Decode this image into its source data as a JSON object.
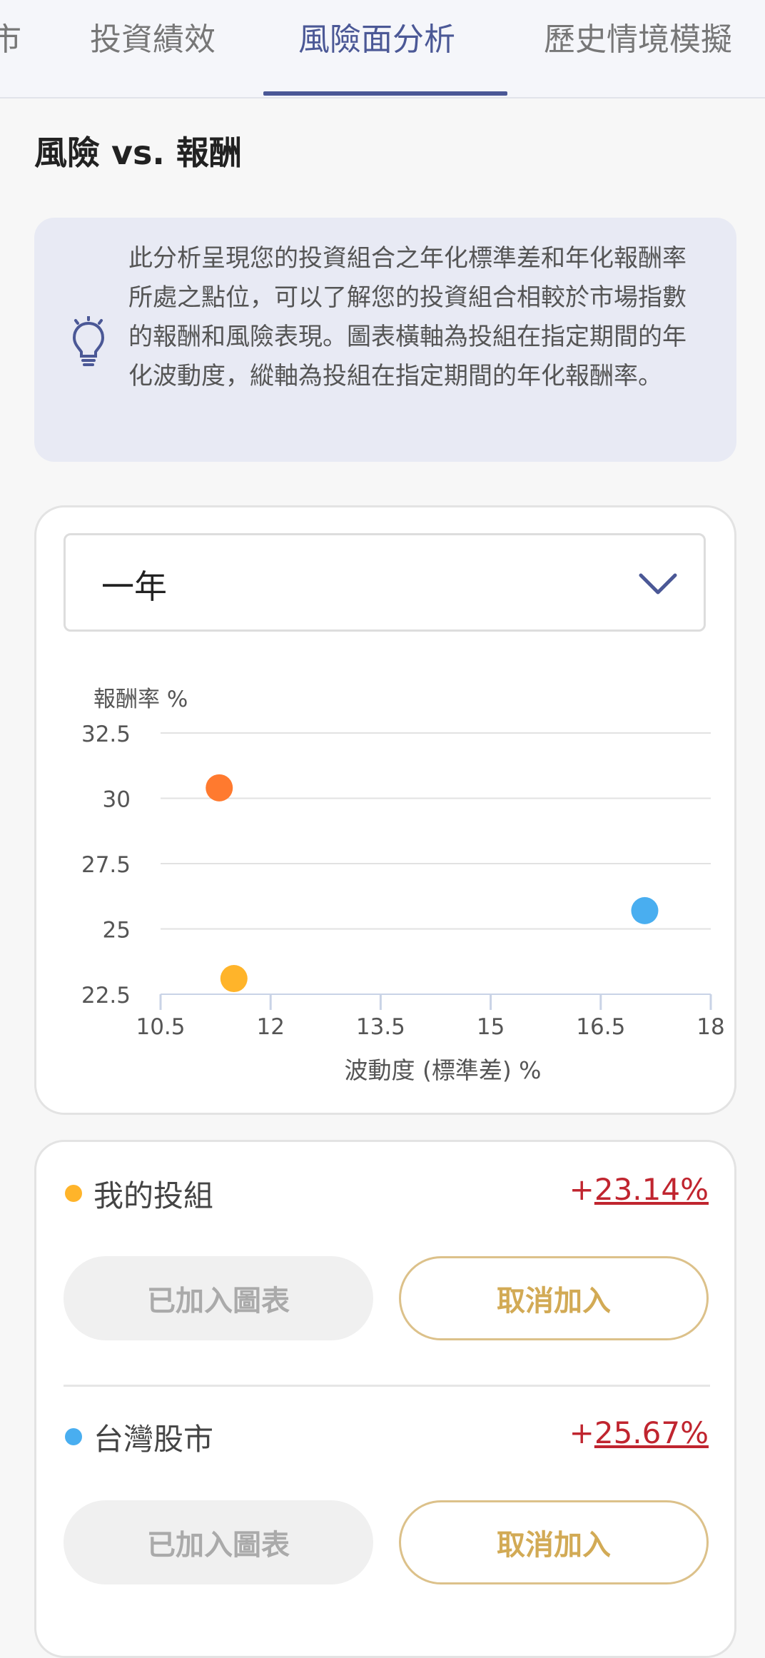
{
  "tabs": [
    {
      "label": "市"
    },
    {
      "label": "投資績效"
    },
    {
      "label": "風險面分析"
    },
    {
      "label": "歷史情境模擬"
    }
  ],
  "section_title": "風險 vs. 報酬",
  "info": {
    "icon": "lightbulb-icon",
    "text": "此分析呈現您的投資組合之年化標準差和年化報酬率所處之點位，可以了解您的投資組合相較於市場指數的報酬和風險表現。圖表橫軸為投組在指定期間的年化波動度，縱軸為投組在指定期間的年化報酬率。"
  },
  "period_select": {
    "value": "一年"
  },
  "chart_data": {
    "type": "scatter",
    "xlabel": "波動度 (標準差) %",
    "ylabel": "報酬率 %",
    "xlim": [
      10.5,
      18
    ],
    "ylim": [
      22.5,
      32.5
    ],
    "xticks": [
      "10.5",
      "12",
      "13.5",
      "15",
      "16.5",
      "18"
    ],
    "yticks": [
      "32.5",
      "30",
      "27.5",
      "25",
      "22.5"
    ],
    "points": [
      {
        "x": 11.3,
        "y": 30.4,
        "color": "#ff7a2f"
      },
      {
        "x": 11.5,
        "y": 23.1,
        "color": "#ffb42a"
      },
      {
        "x": 17.1,
        "y": 25.7,
        "color": "#49aef0"
      }
    ]
  },
  "portfolios": [
    {
      "name": "我的投組",
      "color": "#ffb42a",
      "sign": "+",
      "value": "23.14%",
      "added_label": "已加入圖表",
      "cancel_label": "取消加入"
    },
    {
      "name": "台灣股市",
      "color": "#49aef0",
      "sign": "+",
      "value": "25.67%",
      "added_label": "已加入圖表",
      "cancel_label": "取消加入"
    }
  ]
}
